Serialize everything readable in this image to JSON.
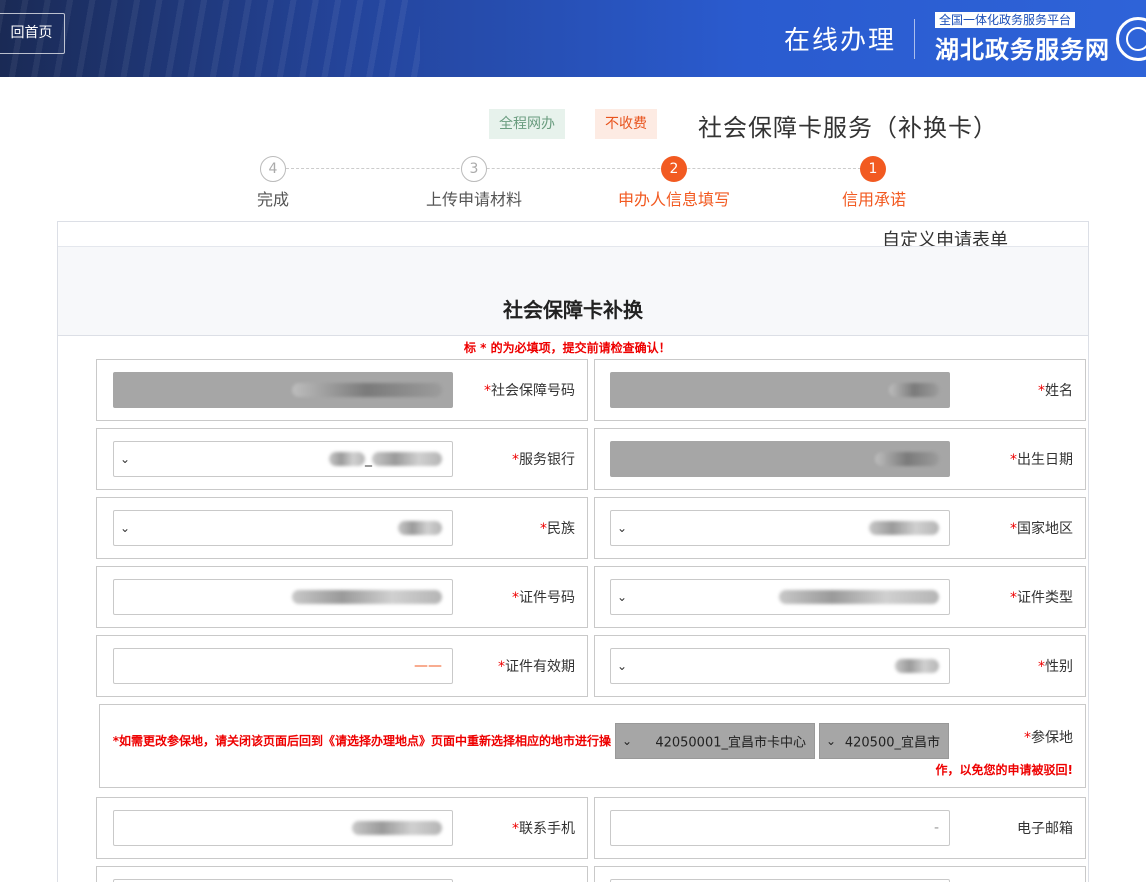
{
  "header": {
    "home_label": "回首页",
    "site_title": "在线办理",
    "brand_sub": "全国一体化政务服务平台",
    "brand_main": "湖北政务服务网"
  },
  "service": {
    "title": "社会保障卡服务（补换卡）",
    "tag_fee": "不收费",
    "tag_online": "全程网办"
  },
  "steps": [
    {
      "num": "1",
      "label": "信用承诺",
      "state": "active"
    },
    {
      "num": "2",
      "label": "申办人信息填写",
      "state": "active"
    },
    {
      "num": "3",
      "label": "上传申请材料",
      "state": "todo"
    },
    {
      "num": "4",
      "label": "完成",
      "state": "todo"
    }
  ],
  "form": {
    "header_title": "自定义申请表单",
    "title": "社会保障卡补换",
    "notice": "标 * 的为必填项，提交前请检查确认！",
    "fields": {
      "name": {
        "label": "姓名",
        "required": true
      },
      "ss_number": {
        "label": "社会保障号码",
        "required": true
      },
      "birth_date": {
        "label": "出生日期",
        "required": true
      },
      "bank": {
        "label": "服务银行",
        "required": true,
        "value": "_"
      },
      "country": {
        "label": "国家地区",
        "required": true
      },
      "ethnicity": {
        "label": "民族",
        "required": true
      },
      "id_type": {
        "label": "证件类型",
        "required": true
      },
      "id_number": {
        "label": "证件号码",
        "required": true
      },
      "gender": {
        "label": "性别",
        "required": true
      },
      "id_validity": {
        "label": "证件有效期",
        "required": true,
        "value": "——"
      },
      "insured_place": {
        "label": "参保地",
        "required": true,
        "city": "420500_宜昌市",
        "center": "42050001_宜昌市卡中心",
        "note_line1": "*如需更改参保地，请关闭该页面后回到《请选择办理地点》页面中重新选择相应的地市进行操",
        "note_line2": "作，以免您的申请被驳回!"
      },
      "email": {
        "label": "电子邮箱",
        "required": false,
        "value": "-"
      },
      "phone": {
        "label": "联系手机",
        "required": true
      }
    }
  }
}
